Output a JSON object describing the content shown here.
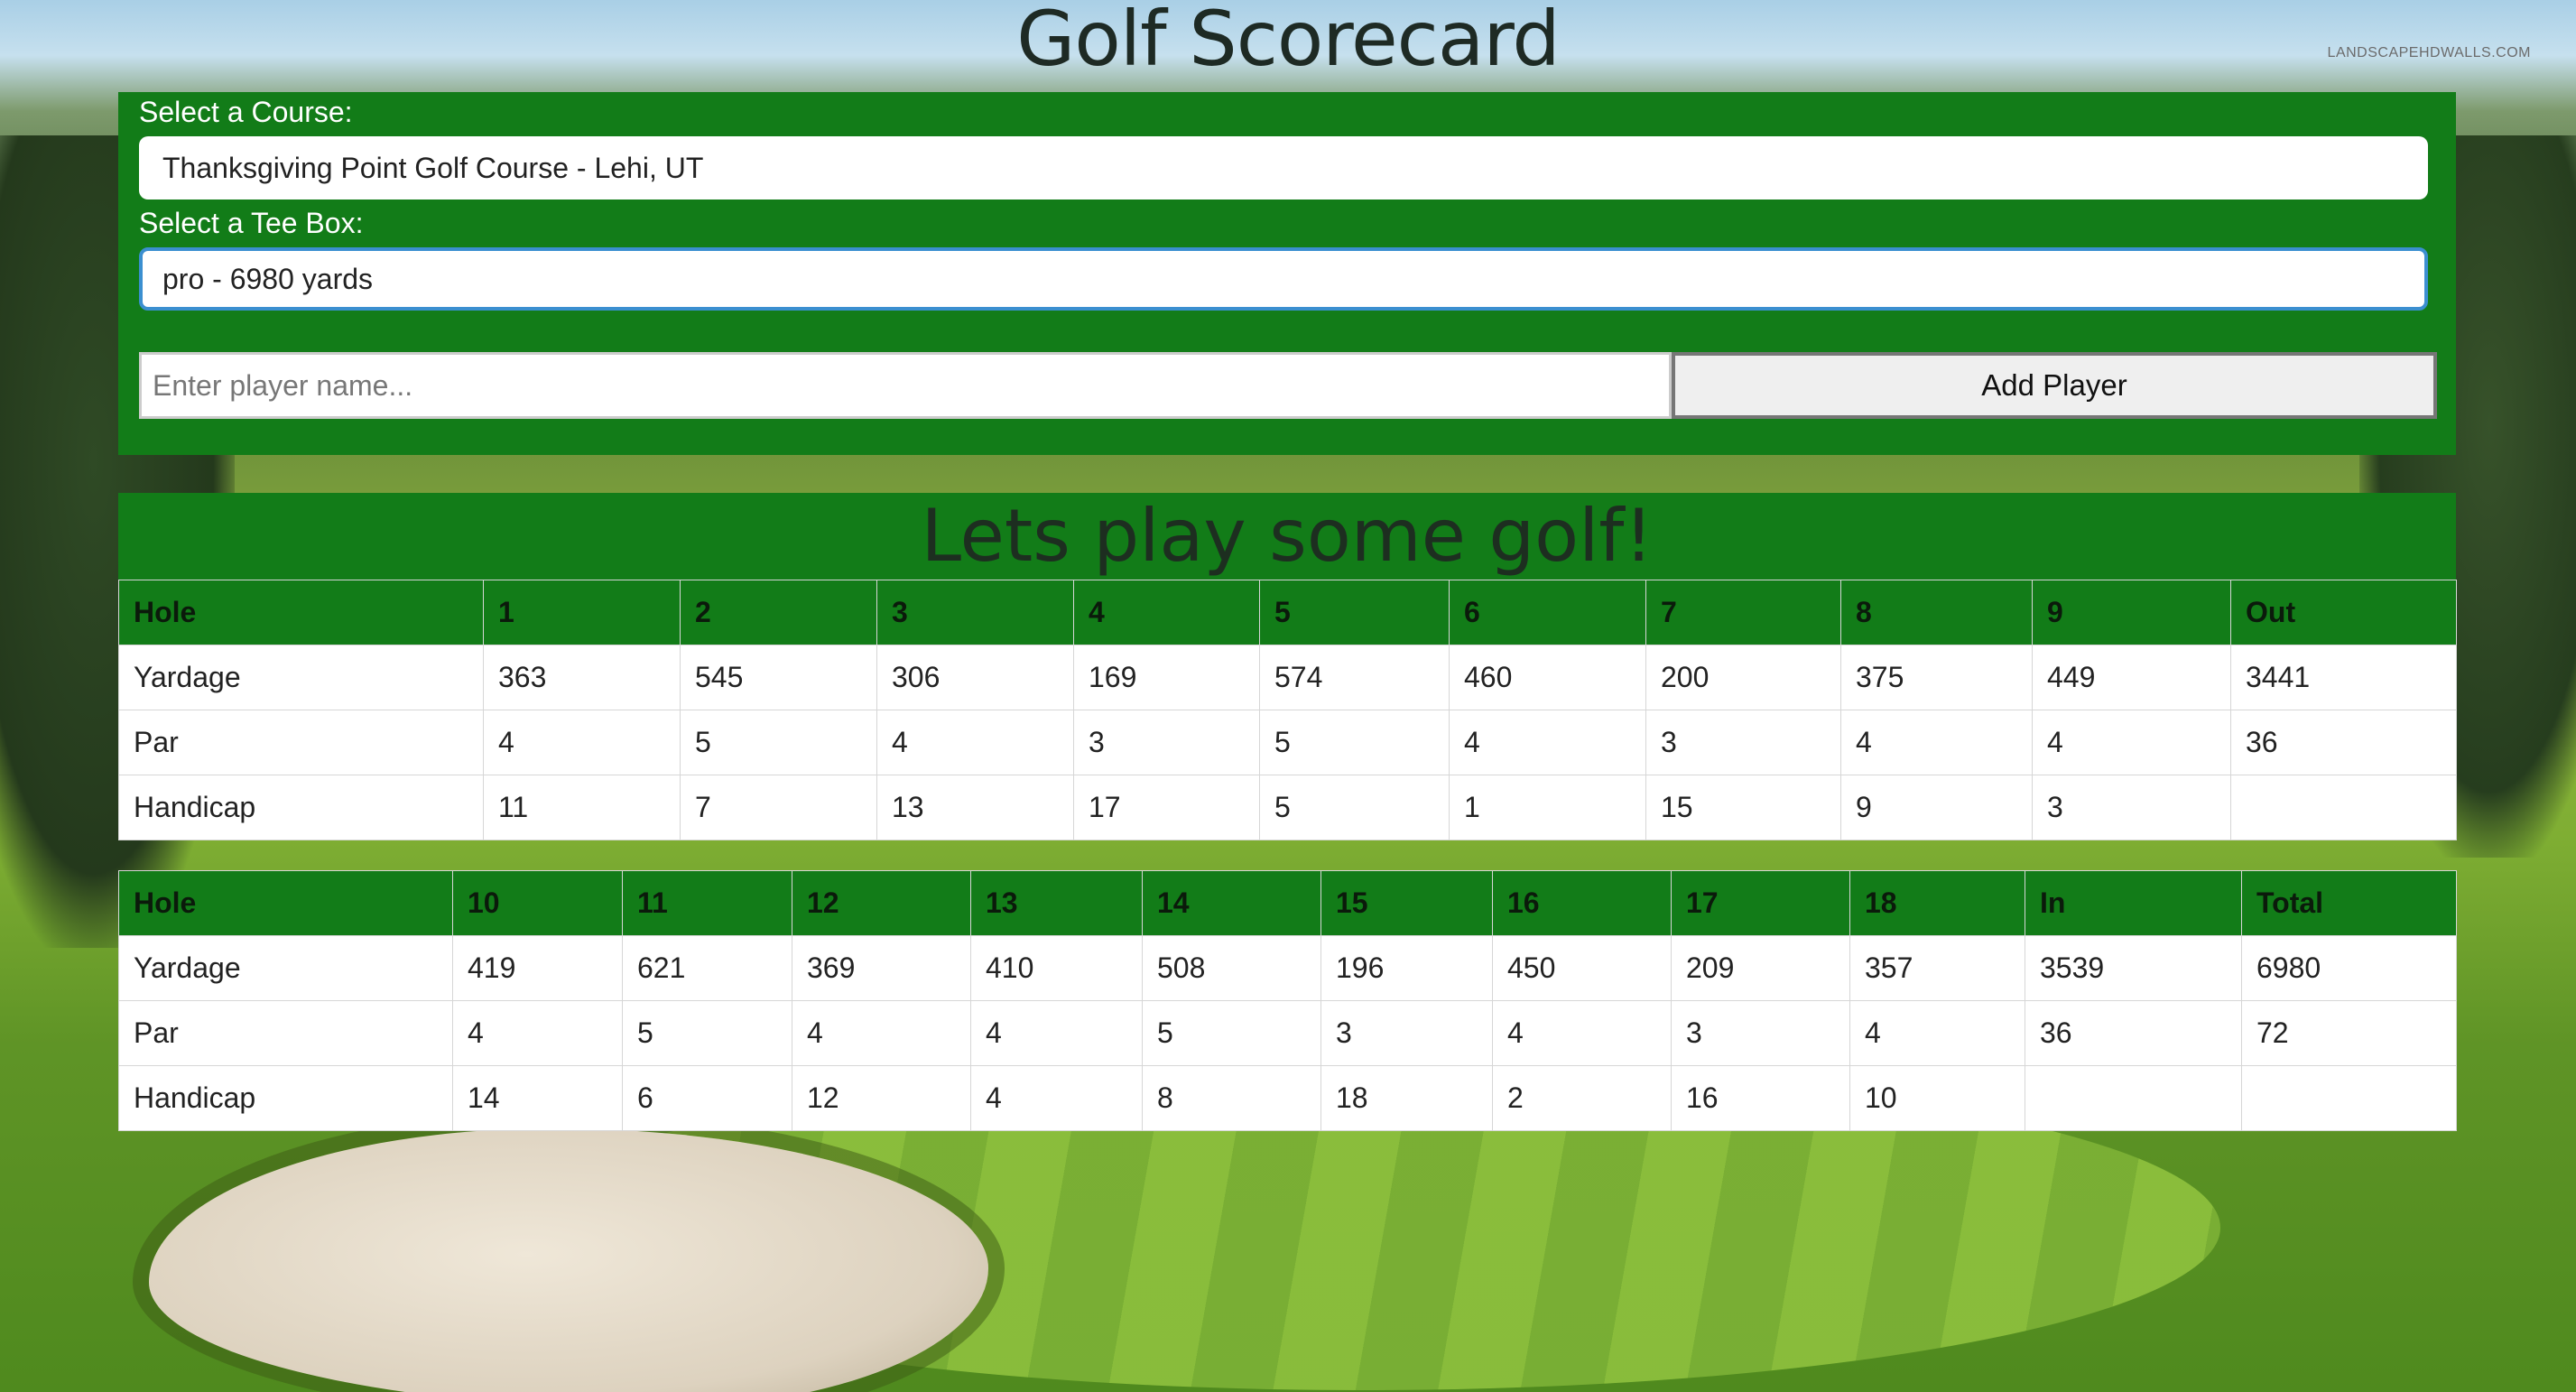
{
  "title": "Golf Scorecard",
  "watermark": "LANDSCAPEHDWALLS.COM",
  "course": {
    "label": "Select a Course:",
    "value": "Thanksgiving Point Golf Course - Lehi, UT"
  },
  "tee": {
    "label": "Select a Tee Box:",
    "value": "pro - 6980 yards"
  },
  "player": {
    "placeholder": "Enter player name...",
    "add_label": "Add Player"
  },
  "banner": "Lets play some golf!",
  "front": {
    "headers": [
      "Hole",
      "1",
      "2",
      "3",
      "4",
      "5",
      "6",
      "7",
      "8",
      "9",
      "Out"
    ],
    "rows": [
      [
        "Yardage",
        "363",
        "545",
        "306",
        "169",
        "574",
        "460",
        "200",
        "375",
        "449",
        "3441"
      ],
      [
        "Par",
        "4",
        "5",
        "4",
        "3",
        "5",
        "4",
        "3",
        "4",
        "4",
        "36"
      ],
      [
        "Handicap",
        "11",
        "7",
        "13",
        "17",
        "5",
        "1",
        "15",
        "9",
        "3",
        ""
      ]
    ]
  },
  "back": {
    "headers": [
      "Hole",
      "10",
      "11",
      "12",
      "13",
      "14",
      "15",
      "16",
      "17",
      "18",
      "In",
      "Total"
    ],
    "rows": [
      [
        "Yardage",
        "419",
        "621",
        "369",
        "410",
        "508",
        "196",
        "450",
        "209",
        "357",
        "3539",
        "6980"
      ],
      [
        "Par",
        "4",
        "5",
        "4",
        "4",
        "5",
        "3",
        "4",
        "3",
        "4",
        "36",
        "72"
      ],
      [
        "Handicap",
        "14",
        "6",
        "12",
        "4",
        "8",
        "18",
        "2",
        "16",
        "10",
        "",
        ""
      ]
    ]
  },
  "colors": {
    "panel": "#127c18",
    "title": "#1e2a24"
  }
}
